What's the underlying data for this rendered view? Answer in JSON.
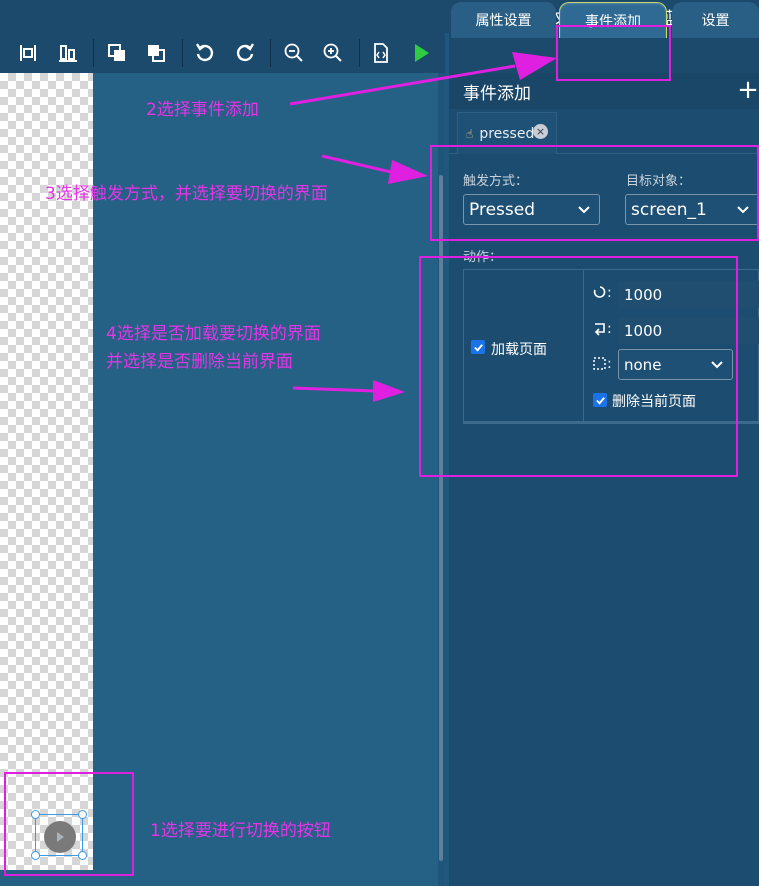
{
  "topbar": {
    "language": "中文",
    "theme": "深蓝色"
  },
  "toolbar": {
    "buttons": [
      "align-left-icon",
      "align-bottom-icon",
      "bring-forward-icon",
      "send-backward-icon",
      "undo-icon",
      "redo-icon",
      "zoom-out-icon",
      "zoom-in-icon",
      "code-icon",
      "run-icon"
    ]
  },
  "tabs": {
    "props": "属性设置",
    "events": "事件添加",
    "settings": "设置"
  },
  "panel": {
    "title": "事件添加",
    "add": "+"
  },
  "event": {
    "name": "pressed",
    "close": "×",
    "trigger_label": "触发方式：",
    "trigger_value": "Pressed",
    "target_label": "目标对象：",
    "target_value": "screen_1",
    "action_label": "动作：",
    "load_page": "加载页面",
    "load_page_checked": true,
    "value1": "1000",
    "value2": "1000",
    "anim_value": "none",
    "delete_current": "删除当前页面",
    "delete_current_checked": true
  },
  "annotations": {
    "a1": "1选择要进行切换的按钮",
    "a2": "2选择事件添加",
    "a3": "3选择触发方式，并选择要切换的界面",
    "a4_line1": "4选择是否加载要切换的界面",
    "a4_line2": "并选择是否删除当前界面"
  },
  "colors": {
    "annotation": "#e020e0",
    "panel": "#1c4c70",
    "canvas": "#256085",
    "run": "#2ecc40"
  }
}
